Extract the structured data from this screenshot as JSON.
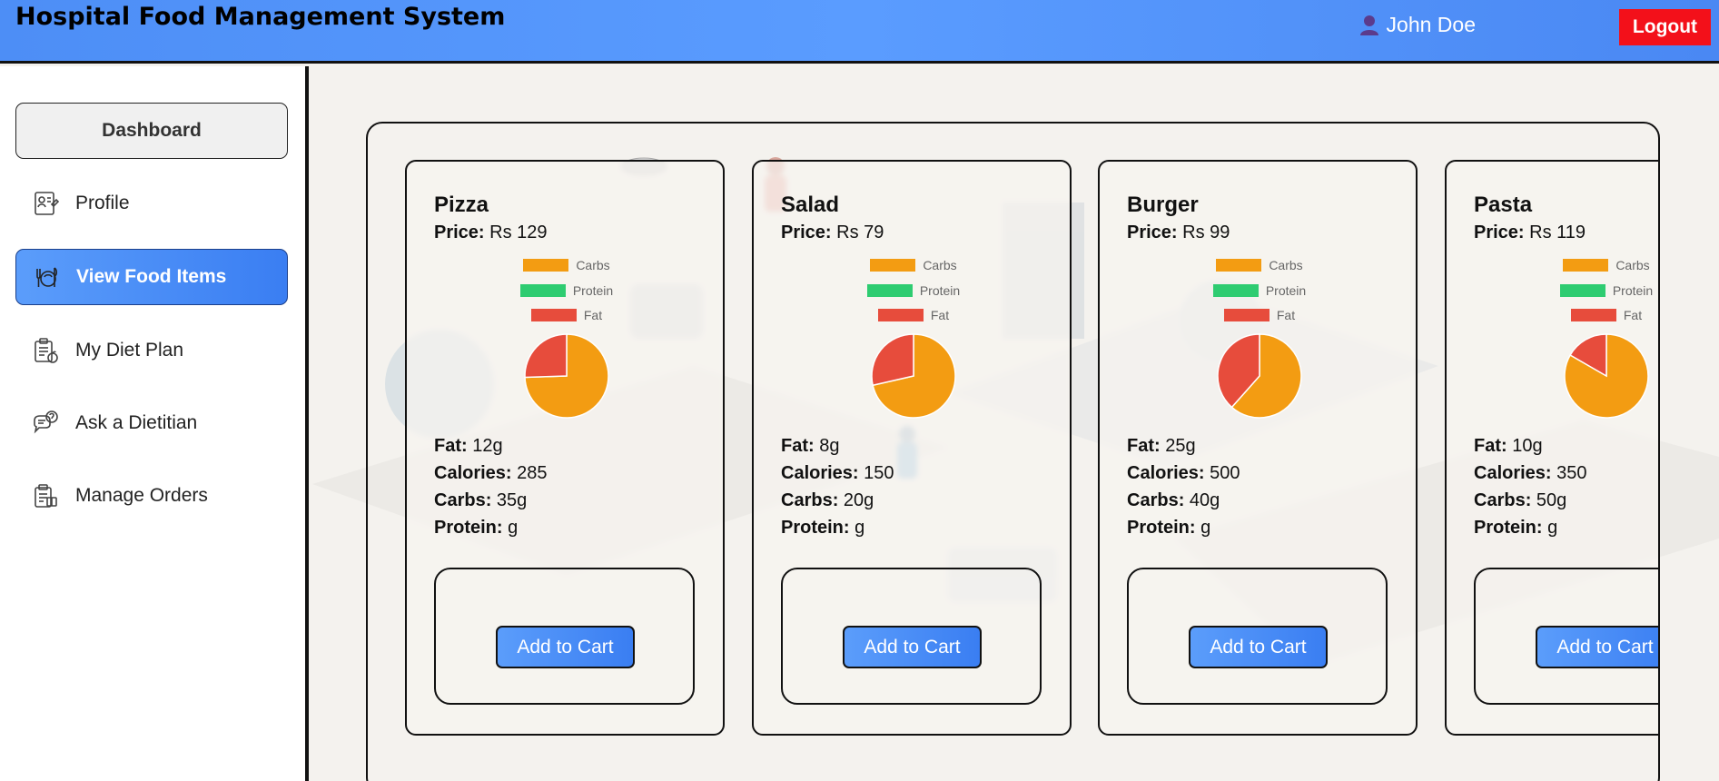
{
  "header": {
    "title": "Hospital Food Management System",
    "user_name": "John Doe",
    "logout_label": "Logout"
  },
  "sidebar": {
    "items": [
      {
        "label": "Dashboard",
        "icon": "dashboard"
      },
      {
        "label": "Profile",
        "icon": "profile-icon"
      },
      {
        "label": "View Food Items",
        "icon": "food-icon",
        "active": true
      },
      {
        "label": "My Diet Plan",
        "icon": "diet-plan-icon"
      },
      {
        "label": "Ask a Dietitian",
        "icon": "chat-icon"
      },
      {
        "label": "Manage Orders",
        "icon": "orders-icon"
      }
    ]
  },
  "labels": {
    "price": "Price:",
    "fat": "Fat:",
    "calories": "Calories:",
    "carbs": "Carbs:",
    "protein": "Protein:",
    "add_to_cart": "Add to Cart",
    "legend_carbs": "Carbs",
    "legend_protein": "Protein",
    "legend_fat": "Fat"
  },
  "colors": {
    "carbs": "#f39c12",
    "protein": "#2ecc71",
    "fat": "#e74c3c",
    "accent": "#4a88f3",
    "logout": "#f3101a"
  },
  "food_items": [
    {
      "name": "Pizza",
      "price": "Rs 129",
      "fat": "12g",
      "calories": "285",
      "carbs": "35g",
      "protein": "g"
    },
    {
      "name": "Salad",
      "price": "Rs 79",
      "fat": "8g",
      "calories": "150",
      "carbs": "20g",
      "protein": "g"
    },
    {
      "name": "Burger",
      "price": "Rs 99",
      "fat": "25g",
      "calories": "500",
      "carbs": "40g",
      "protein": "g"
    },
    {
      "name": "Pasta",
      "price": "Rs 119",
      "fat": "10g",
      "calories": "350",
      "carbs": "50g",
      "protein": "g"
    }
  ],
  "chart_data": [
    {
      "type": "pie",
      "categories": [
        "Carbs",
        "Protein",
        "Fat"
      ],
      "values": [
        35,
        0,
        12
      ]
    },
    {
      "type": "pie",
      "categories": [
        "Carbs",
        "Protein",
        "Fat"
      ],
      "values": [
        20,
        0,
        8
      ]
    },
    {
      "type": "pie",
      "categories": [
        "Carbs",
        "Protein",
        "Fat"
      ],
      "values": [
        40,
        0,
        25
      ]
    },
    {
      "type": "pie",
      "categories": [
        "Carbs",
        "Protein",
        "Fat"
      ],
      "values": [
        50,
        0,
        10
      ]
    }
  ]
}
